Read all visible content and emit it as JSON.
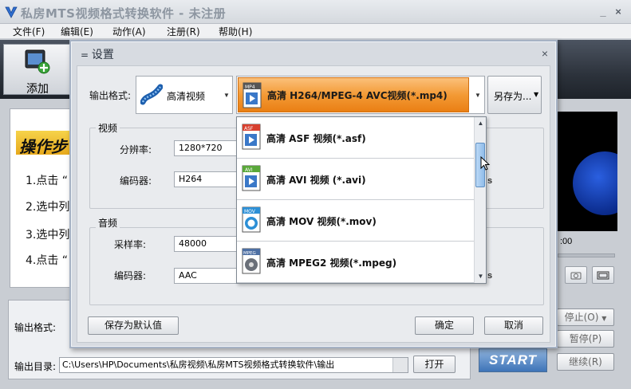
{
  "app": {
    "title": "私房MTS视频格式转换软件 - 未注册",
    "minimize": "_",
    "close": "×"
  },
  "menu": [
    "文件(F)",
    "编辑(E)",
    "动作(A)",
    "注册(R)",
    "帮助(H)"
  ],
  "toolbar": {
    "add_label": "添加"
  },
  "steps": {
    "title": "操作步",
    "items": [
      "1.点击 “",
      "2.选中列",
      "3.选中列",
      "4.点击 “"
    ]
  },
  "preview": {
    "time": ":00"
  },
  "bottom": {
    "output_format_label": "输出格式:",
    "output_dir_label": "输出目录:",
    "output_dir_value": "C:\\Users\\HP\\Documents\\私房视频\\私房MTS视频格式转换软件\\输出",
    "open_button": "打开",
    "start_button": "START",
    "stop_button": "停止(O)",
    "pause_button": "暂停(P)",
    "resume_button": "继续(R)"
  },
  "dialog": {
    "title": "设置",
    "close": "×",
    "output_format_label": "输出格式:",
    "format_category": "高清视频",
    "selected_preset": "高清 H264/MPEG-4 AVC视频(*.mp4)",
    "save_as_button": "另存为...",
    "video_group": "视频",
    "resolution_label": "分辨率:",
    "resolution_value": "1280*720",
    "video_codec_label": "编码器:",
    "video_codec_value": "H264",
    "audio_group": "音频",
    "sample_rate_label": "采样率:",
    "sample_rate_value": "48000",
    "audio_codec_label": "编码器:",
    "audio_codec_value": "AAC",
    "right_unit_1": "s",
    "right_unit_2": "s",
    "save_default_button": "保存为默认值",
    "ok_button": "确定",
    "cancel_button": "取消",
    "dropdown": [
      {
        "label": "高清 ASF 视频(*.asf)",
        "badge": "ASF",
        "icon": "asf-file-icon",
        "color": "#d8402f"
      },
      {
        "label": "高清 AVI 视频 (*.avi)",
        "badge": "AVI",
        "icon": "avi-file-icon",
        "color": "#5aa83a"
      },
      {
        "label": "高清 MOV 视频(*.mov)",
        "badge": "MOV",
        "icon": "mov-file-icon",
        "color": "#2c8fd6"
      },
      {
        "label": "高清 MPEG2 视频(*.mpeg)",
        "badge": "MPEG",
        "icon": "mpeg-file-icon",
        "color": "#4d6fa3"
      }
    ],
    "selected_badge": "MP4"
  },
  "colors": {
    "accent_orange": "#f39a35",
    "start_blue": "#3e74b8",
    "dialog_border": "#a6b2c4"
  }
}
